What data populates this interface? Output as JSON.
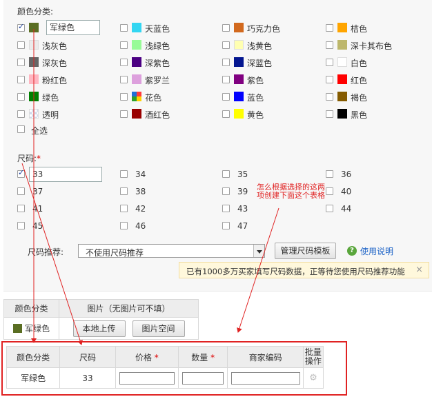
{
  "colors": {
    "section_label": "颜色分类:",
    "items": [
      {
        "name": "军绿色",
        "color": "#5a6e23",
        "checked": true
      },
      {
        "name": "天蓝色",
        "color": "#33d6f2",
        "checked": false
      },
      {
        "name": "巧克力色",
        "color": "#d2691e",
        "checked": false
      },
      {
        "name": "桔色",
        "color": "#ffa500",
        "checked": false
      },
      {
        "name": "浅灰色",
        "color": "#ebebeb",
        "checked": false
      },
      {
        "name": "浅绿色",
        "color": "#98fb98",
        "checked": false
      },
      {
        "name": "浅黄色",
        "color": "#ffffb1",
        "checked": false
      },
      {
        "name": "深卡其布色",
        "color": "#bdb76b",
        "checked": false
      },
      {
        "name": "深灰色",
        "color": "#666666",
        "checked": false
      },
      {
        "name": "深紫色",
        "color": "#4b0082",
        "checked": false
      },
      {
        "name": "深蓝色",
        "color": "#041690",
        "checked": false
      },
      {
        "name": "白色",
        "color": "#ffffff",
        "checked": false
      },
      {
        "name": "粉红色",
        "color": "#ffb6c1",
        "checked": false
      },
      {
        "name": "紫罗兰",
        "color": "#dda0dd",
        "checked": false
      },
      {
        "name": "紫色",
        "color": "#800080",
        "checked": false
      },
      {
        "name": "红色",
        "color": "#ff0000",
        "checked": false
      },
      {
        "name": "绿色",
        "color": "#008000",
        "checked": false
      },
      {
        "name": "花色",
        "color": "multi",
        "checked": false
      },
      {
        "name": "蓝色",
        "color": "#0000fe",
        "checked": false
      },
      {
        "name": "褐色",
        "color": "#855b00",
        "checked": false
      },
      {
        "name": "透明",
        "color": "transparent",
        "checked": false
      },
      {
        "name": "酒红色",
        "color": "#990000",
        "checked": false
      },
      {
        "name": "黄色",
        "color": "#ffff00",
        "checked": false
      },
      {
        "name": "黑色",
        "color": "#000000",
        "checked": false
      }
    ],
    "select_all": "全选"
  },
  "sizes": {
    "section_label": "尺码:",
    "required_mark": "*",
    "items": [
      {
        "value": "33",
        "checked": true
      },
      {
        "value": "34",
        "checked": false
      },
      {
        "value": "35",
        "checked": false
      },
      {
        "value": "36",
        "checked": false
      },
      {
        "value": "37",
        "checked": false
      },
      {
        "value": "38",
        "checked": false
      },
      {
        "value": "39",
        "checked": false
      },
      {
        "value": "40",
        "checked": false
      },
      {
        "value": "41",
        "checked": false
      },
      {
        "value": "42",
        "checked": false
      },
      {
        "value": "43",
        "checked": false
      },
      {
        "value": "44",
        "checked": false
      },
      {
        "value": "45",
        "checked": false
      },
      {
        "value": "46",
        "checked": false
      },
      {
        "value": "47",
        "checked": false
      }
    ]
  },
  "recommend": {
    "label": "尺码推荐:",
    "selected": "不使用尺码推荐",
    "manage_button": "管理尺码模板",
    "help_link": "使用说明",
    "notice": "已有1000多万买家填写尺码数据，正等待您使用尺码推荐功能",
    "notice_close": "×"
  },
  "image_table": {
    "headers": [
      "颜色分类",
      "图片（无图片可不填）"
    ],
    "row": {
      "color_name": "军绿色",
      "color": "#5a6e23"
    },
    "upload_button": "本地上传",
    "space_button": "图片空间"
  },
  "sku_table": {
    "headers": [
      "颜色分类",
      "尺码",
      "价格",
      "数量",
      "商家编码",
      "批量操作"
    ],
    "required_mark": "*",
    "row": {
      "color": "军绿色",
      "size": "33"
    }
  },
  "annotation": "怎么根据选择的这两项创建下面这个表格"
}
